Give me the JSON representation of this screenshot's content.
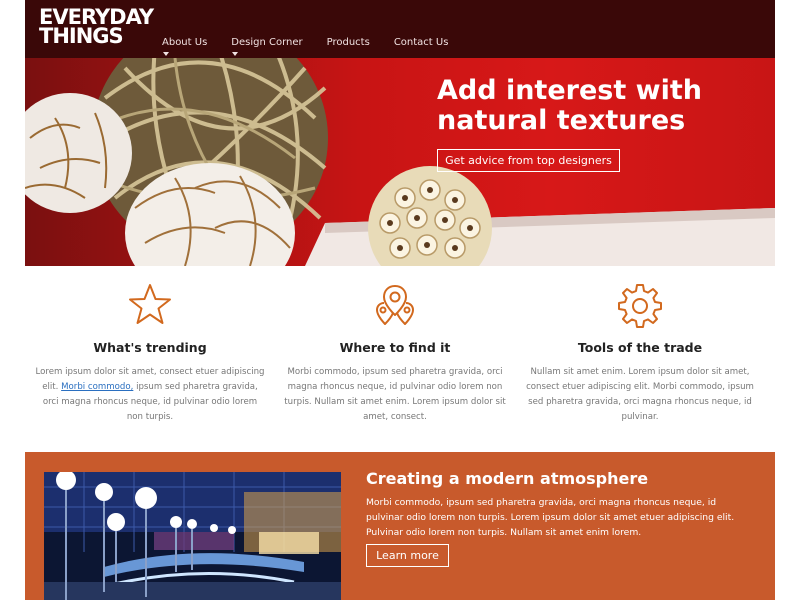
{
  "brand": {
    "logo_line1": "EVERYDAY",
    "logo_line2": "THINGS"
  },
  "nav": {
    "items": [
      "About Us",
      "Design Corner",
      "Products",
      "Contact Us"
    ]
  },
  "hero": {
    "title_line1": "Add interest with",
    "title_line2": "natural textures",
    "button": "Get advice from top designers"
  },
  "features": [
    {
      "icon": "star-icon",
      "title": "What's trending",
      "text_before": "Lorem ipsum dolor sit amet, consect etuer adipiscing elit. ",
      "link": "Morbi commodo,",
      "text_after": " ipsum sed pharetra gravida, orci magna rhoncus neque, id pulvinar odio lorem non turpis."
    },
    {
      "icon": "location-pins-icon",
      "title": "Where to find it",
      "text": "Morbi commodo, ipsum sed pharetra gravida, orci magna rhoncus neque, id pulvinar odio lorem non turpis. Nullam sit amet enim. Lorem ipsum dolor sit amet, consect."
    },
    {
      "icon": "gear-icon",
      "title": "Tools of the trade",
      "text": "Nullam sit amet enim. Lorem ipsum dolor sit amet, consect etuer adipiscing elit. Morbi commodo, ipsum sed pharetra gravida, orci magna rhoncus neque, id pulvinar."
    }
  ],
  "promo": {
    "title": "Creating a modern atmosphere",
    "text": "Morbi commodo, ipsum sed pharetra gravida, orci magna rhoncus neque, id pulvinar odio lorem non turpis. Lorem ipsum dolor sit amet etuer adipiscing elit. Pulvinar odio lorem non turpis. Nullam sit amet enim lorem.",
    "button": "Learn more"
  },
  "colors": {
    "header_bg": "#3a0808",
    "hero_red": "#d71818",
    "accent_orange": "#c85a2c",
    "icon_orange": "#d2691e",
    "link_blue": "#2a6fc0"
  }
}
